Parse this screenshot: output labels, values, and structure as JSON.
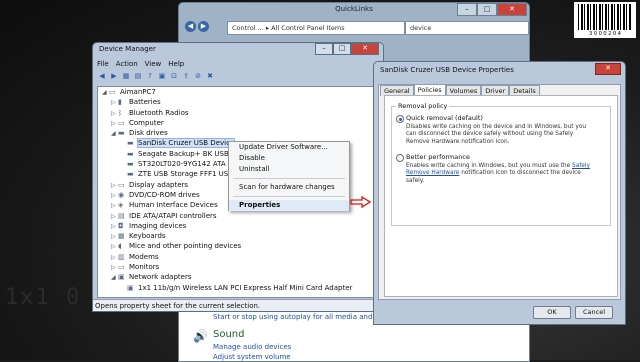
{
  "control_panel": {
    "title": "QuickLinks",
    "address": "Control ... ▸ All Control Panel Items",
    "search_placeholder": "device",
    "autoplay_link": "Start or stop using autoplay for all media and devices",
    "sound_heading": "Sound",
    "manage_audio_link": "Manage audio devices",
    "adjust_volume_link": "Adjust system volume"
  },
  "barcode": {
    "digits": "3 0 0 0 2 0 4"
  },
  "device_manager": {
    "title": "Device Manager",
    "menu": [
      "File",
      "Action",
      "View",
      "Help"
    ],
    "tree": [
      {
        "label": "AimanPC7",
        "exp": "◢",
        "icon": "computer-icon",
        "indent": 0
      },
      {
        "label": "Batteries",
        "exp": "▷",
        "icon": "battery-icon",
        "indent": 1
      },
      {
        "label": "Bluetooth Radios",
        "exp": "▷",
        "icon": "bluetooth-icon",
        "indent": 1
      },
      {
        "label": "Computer",
        "exp": "▷",
        "icon": "computer-icon",
        "indent": 1
      },
      {
        "label": "Disk drives",
        "exp": "◢",
        "icon": "disk-icon",
        "indent": 1
      },
      {
        "label": "SanDisk Cruzer USB Device",
        "exp": "",
        "icon": "disk-icon",
        "indent": 2,
        "selected": true
      },
      {
        "label": "Seagate Backup+ BK USB Device",
        "exp": "",
        "icon": "disk-icon",
        "indent": 2
      },
      {
        "label": "ST320LT020-9YG142 ATA Device",
        "exp": "",
        "icon": "disk-icon",
        "indent": 2
      },
      {
        "label": "ZTE USB Storage FFF1 USB Device",
        "exp": "",
        "icon": "disk-icon",
        "indent": 2
      },
      {
        "label": "Display adapters",
        "exp": "▷",
        "icon": "monitor-icon",
        "indent": 1
      },
      {
        "label": "DVD/CD-ROM drives",
        "exp": "▷",
        "icon": "disc-icon",
        "indent": 1
      },
      {
        "label": "Human Interface Devices",
        "exp": "▷",
        "icon": "hid-icon",
        "indent": 1
      },
      {
        "label": "IDE ATA/ATAPI controllers",
        "exp": "▷",
        "icon": "controller-icon",
        "indent": 1
      },
      {
        "label": "Imaging devices",
        "exp": "▷",
        "icon": "camera-icon",
        "indent": 1
      },
      {
        "label": "Keyboards",
        "exp": "▷",
        "icon": "keyboard-icon",
        "indent": 1
      },
      {
        "label": "Mice and other pointing devices",
        "exp": "▷",
        "icon": "mouse-icon",
        "indent": 1
      },
      {
        "label": "Modems",
        "exp": "▷",
        "icon": "modem-icon",
        "indent": 1
      },
      {
        "label": "Monitors",
        "exp": "▷",
        "icon": "monitor-icon",
        "indent": 1
      },
      {
        "label": "Network adapters",
        "exp": "◢",
        "icon": "network-icon",
        "indent": 1
      },
      {
        "label": "1x1 11b/g/n Wireless LAN PCI Express Half Mini Card Adapter",
        "exp": "",
        "icon": "network-icon",
        "indent": 2
      }
    ],
    "status": "Opens property sheet for the current selection."
  },
  "context_menu": {
    "items": [
      "Update Driver Software...",
      "Disable",
      "Uninstall",
      "Scan for hardware changes",
      "Properties"
    ]
  },
  "properties": {
    "title": "SanDisk Cruzer USB Device Properties",
    "tabs": [
      "General",
      "Policies",
      "Volumes",
      "Driver",
      "Details"
    ],
    "active_tab": "Policies",
    "group_label": "Removal policy",
    "option1_title": "Quick removal (default)",
    "option1_desc": "Disables write caching on the device and in Windows, but you can disconnect the device safely without using the Safely Remove Hardware notification icon.",
    "option2_title": "Better performance",
    "option2_desc_pre": "Enables write caching in Windows, but you must use the",
    "option2_link": "Safely Remove Hardware",
    "option2_desc_post": "notification icon to disconnect the device safely.",
    "ok_label": "OK",
    "cancel_label": "Cancel"
  }
}
